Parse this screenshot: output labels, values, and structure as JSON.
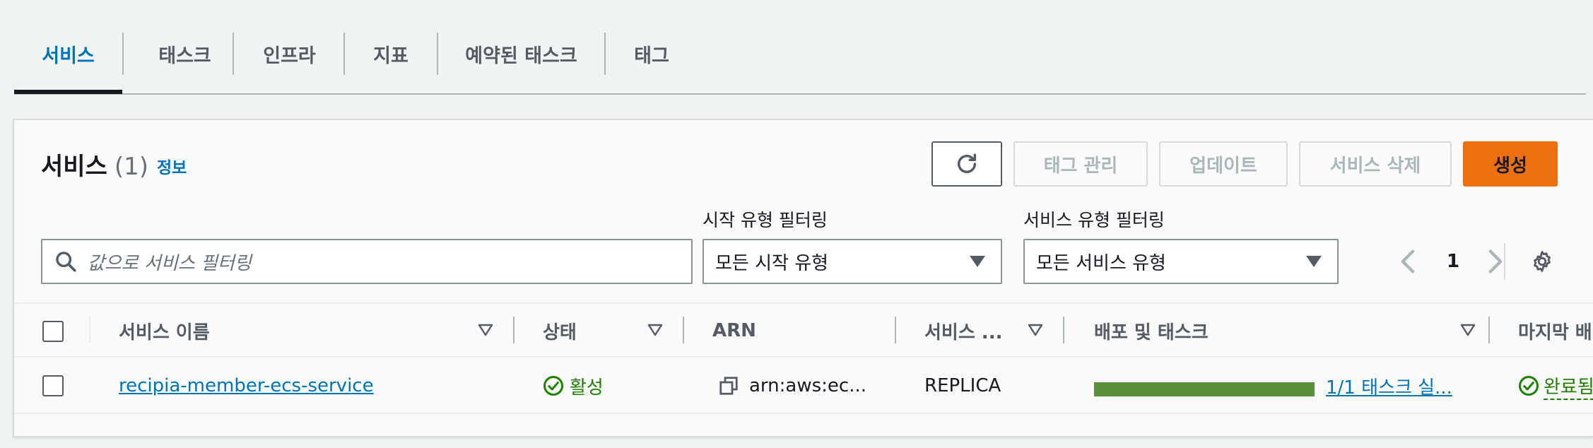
{
  "tabs": [
    {
      "label": "서비스",
      "active": true
    },
    {
      "label": "태스크",
      "active": false
    },
    {
      "label": "인프라",
      "active": false
    },
    {
      "label": "지표",
      "active": false
    },
    {
      "label": "예약된 태스크",
      "active": false
    },
    {
      "label": "태그",
      "active": false
    }
  ],
  "panel": {
    "title": "서비스",
    "count": "(1)",
    "info": "정보",
    "buttons": {
      "manage_tags": "태그 관리",
      "update": "업데이트",
      "delete": "서비스 삭제",
      "create": "생성"
    },
    "search_placeholder": "값으로 서비스 필터링",
    "launch_filter": {
      "label": "시작 유형 필터링",
      "value": "모든 시작 유형"
    },
    "service_filter": {
      "label": "서비스 유형 필터링",
      "value": "모든 서비스 유형"
    },
    "pagination": {
      "page": "1"
    }
  },
  "table": {
    "columns": [
      "서비스 이름",
      "상태",
      "ARN",
      "서비스 ...",
      "배포 및 태스크",
      "마지막 배"
    ],
    "rows": [
      {
        "name": "recipia-member-ecs-service",
        "status": "활성",
        "arn": "arn:aws:ec...",
        "service_type": "REPLICA",
        "deployment_progress": 1.0,
        "tasks": "1/1 태스크 실...",
        "last_deploy": "완료됨"
      }
    ]
  },
  "colors": {
    "accent": "#0073bb",
    "primary_button": "#ec7211",
    "success": "#1d8102",
    "progress_fill": "#5a8f3a"
  }
}
